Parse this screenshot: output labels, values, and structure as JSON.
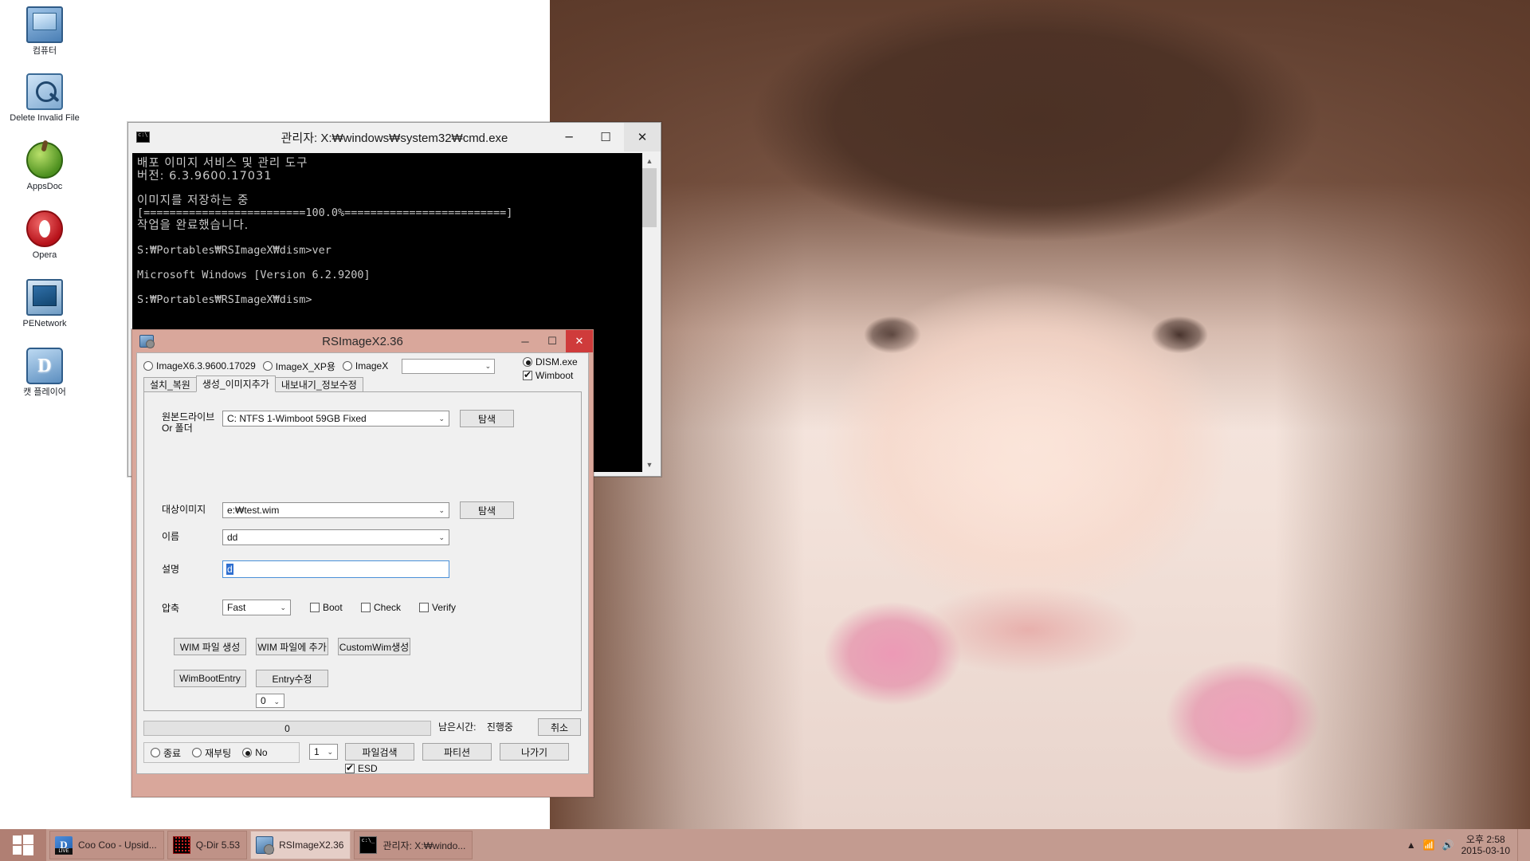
{
  "desktop": {
    "icons": [
      {
        "name": "컴퓨터",
        "icon": "computer-icon"
      },
      {
        "name": "Delete Invalid File",
        "icon": "delete-invalid-file-icon"
      },
      {
        "name": "AppsDoc",
        "icon": "apps-icon"
      },
      {
        "name": "Opera",
        "icon": "opera-icon"
      },
      {
        "name": "PENetwork",
        "icon": "network-icon"
      },
      {
        "name": "캣 플레이어",
        "icon": "cat-player-icon"
      }
    ]
  },
  "cmd_window": {
    "title": "관리자: X:₩windows₩system32₩cmd.exe",
    "icon": "cmd-icon",
    "buttons": {
      "minimize": "─",
      "maximize": "☐",
      "close": "✕"
    },
    "console_lines": [
      "배포 이미지 서비스 및 관리 도구",
      "버전: 6.3.9600.17031",
      "",
      "이미지를 저장하는 중",
      "[=========================100.0%=========================]",
      "작업을 완료했습니다.",
      "",
      "S:₩Portables₩RSImageX₩dism>ver",
      "",
      "Microsoft Windows [Version 6.2.9200]",
      "",
      "S:₩Portables₩RSImageX₩dism>"
    ],
    "scrollbar": {
      "up": "▲",
      "down": "▼"
    }
  },
  "rsimagex": {
    "title": "RSImageX2.36",
    "icon": "rsimagex-icon",
    "buttons": {
      "minimize": "─",
      "maximize": "☐",
      "close": "✕"
    },
    "engines": [
      {
        "label": "ImageX6.3.9600.17029",
        "selected": false
      },
      {
        "label": "ImageX_XP용",
        "selected": false
      },
      {
        "label": "ImageX",
        "selected": false
      }
    ],
    "engine_combo_value": "",
    "dism_option": {
      "label": "DISM.exe",
      "selected": true
    },
    "wimboot_option": {
      "label": "Wimboot",
      "checked": true
    },
    "tabs": [
      {
        "label": "설치_복원",
        "active": false
      },
      {
        "label": "생성_이미지추가",
        "active": true
      },
      {
        "label": "내보내기_정보수정",
        "active": false
      }
    ],
    "fields": {
      "source_label_line1": "원본드라이브",
      "source_label_line2": "Or 폴더",
      "source_value": "C:  NTFS  1-Wimboot        59GB  Fixed",
      "source_browse": "탐색",
      "target_label": "대상이미지",
      "target_value": "e:₩test.wim",
      "target_browse": "탐색",
      "name_label": "이름",
      "name_value": "dd",
      "desc_label": "설명",
      "desc_value": "d",
      "compress_label": "압축",
      "compress_value": "Fast",
      "boot": {
        "label": "Boot",
        "checked": false
      },
      "check": {
        "label": "Check",
        "checked": false
      },
      "verify": {
        "label": "Verify",
        "checked": false
      },
      "index_value": "0"
    },
    "action_buttons": {
      "wim_create": "WIM 파일 생성",
      "wim_add": "WIM 파일에 추가",
      "custom_wim": "CustomWim생성",
      "wimboot_entry": "WimBootEntry",
      "entry_edit": "Entry수정"
    },
    "status": {
      "progress_value": "0",
      "remain_label": "남은시간:",
      "remain_value": "진행중",
      "cancel": "취소"
    },
    "bottom": {
      "exit_option": {
        "label": "종료",
        "selected": false
      },
      "reboot_option": {
        "label": "재부팅",
        "selected": false
      },
      "no_option": {
        "label": "No",
        "selected": true
      },
      "count_value": "1",
      "file_search": "파일검색",
      "partition": "파티션",
      "quit": "나가기",
      "esd": {
        "label": "ESD",
        "checked": true
      }
    }
  },
  "taskbar": {
    "start_icon": "windows-start-icon",
    "items": [
      {
        "label": "Coo Coo - Upsid...",
        "icon": "media-player-icon",
        "active": false
      },
      {
        "label": "Q-Dir 5.53",
        "icon": "qdir-icon",
        "active": false
      },
      {
        "label": "RSImageX2.36",
        "icon": "rsimagex-icon",
        "active": true
      },
      {
        "label": "관리자: X:₩windo...",
        "icon": "cmd-icon",
        "active": false
      }
    ],
    "tray": {
      "chevron": "▲",
      "network_icon": "network-tray-icon",
      "volume_icon": "volume-tray-icon",
      "time": "오후 2:58",
      "date": "2015-03-10"
    }
  }
}
